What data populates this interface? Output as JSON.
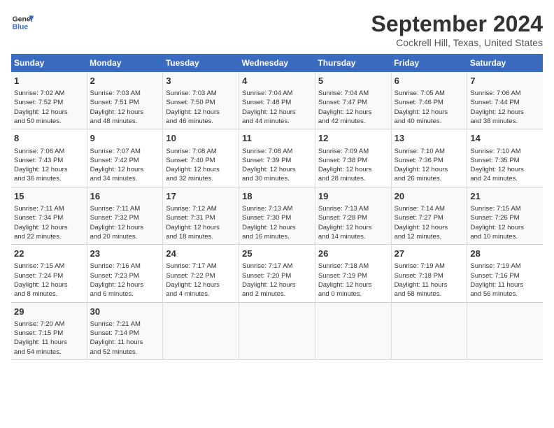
{
  "header": {
    "logo_line1": "General",
    "logo_line2": "Blue",
    "title": "September 2024",
    "subtitle": "Cockrell Hill, Texas, United States"
  },
  "days_of_week": [
    "Sunday",
    "Monday",
    "Tuesday",
    "Wednesday",
    "Thursday",
    "Friday",
    "Saturday"
  ],
  "weeks": [
    [
      {
        "day": "1",
        "info": "Sunrise: 7:02 AM\nSunset: 7:52 PM\nDaylight: 12 hours\nand 50 minutes."
      },
      {
        "day": "2",
        "info": "Sunrise: 7:03 AM\nSunset: 7:51 PM\nDaylight: 12 hours\nand 48 minutes."
      },
      {
        "day": "3",
        "info": "Sunrise: 7:03 AM\nSunset: 7:50 PM\nDaylight: 12 hours\nand 46 minutes."
      },
      {
        "day": "4",
        "info": "Sunrise: 7:04 AM\nSunset: 7:48 PM\nDaylight: 12 hours\nand 44 minutes."
      },
      {
        "day": "5",
        "info": "Sunrise: 7:04 AM\nSunset: 7:47 PM\nDaylight: 12 hours\nand 42 minutes."
      },
      {
        "day": "6",
        "info": "Sunrise: 7:05 AM\nSunset: 7:46 PM\nDaylight: 12 hours\nand 40 minutes."
      },
      {
        "day": "7",
        "info": "Sunrise: 7:06 AM\nSunset: 7:44 PM\nDaylight: 12 hours\nand 38 minutes."
      }
    ],
    [
      {
        "day": "8",
        "info": "Sunrise: 7:06 AM\nSunset: 7:43 PM\nDaylight: 12 hours\nand 36 minutes."
      },
      {
        "day": "9",
        "info": "Sunrise: 7:07 AM\nSunset: 7:42 PM\nDaylight: 12 hours\nand 34 minutes."
      },
      {
        "day": "10",
        "info": "Sunrise: 7:08 AM\nSunset: 7:40 PM\nDaylight: 12 hours\nand 32 minutes."
      },
      {
        "day": "11",
        "info": "Sunrise: 7:08 AM\nSunset: 7:39 PM\nDaylight: 12 hours\nand 30 minutes."
      },
      {
        "day": "12",
        "info": "Sunrise: 7:09 AM\nSunset: 7:38 PM\nDaylight: 12 hours\nand 28 minutes."
      },
      {
        "day": "13",
        "info": "Sunrise: 7:10 AM\nSunset: 7:36 PM\nDaylight: 12 hours\nand 26 minutes."
      },
      {
        "day": "14",
        "info": "Sunrise: 7:10 AM\nSunset: 7:35 PM\nDaylight: 12 hours\nand 24 minutes."
      }
    ],
    [
      {
        "day": "15",
        "info": "Sunrise: 7:11 AM\nSunset: 7:34 PM\nDaylight: 12 hours\nand 22 minutes."
      },
      {
        "day": "16",
        "info": "Sunrise: 7:11 AM\nSunset: 7:32 PM\nDaylight: 12 hours\nand 20 minutes."
      },
      {
        "day": "17",
        "info": "Sunrise: 7:12 AM\nSunset: 7:31 PM\nDaylight: 12 hours\nand 18 minutes."
      },
      {
        "day": "18",
        "info": "Sunrise: 7:13 AM\nSunset: 7:30 PM\nDaylight: 12 hours\nand 16 minutes."
      },
      {
        "day": "19",
        "info": "Sunrise: 7:13 AM\nSunset: 7:28 PM\nDaylight: 12 hours\nand 14 minutes."
      },
      {
        "day": "20",
        "info": "Sunrise: 7:14 AM\nSunset: 7:27 PM\nDaylight: 12 hours\nand 12 minutes."
      },
      {
        "day": "21",
        "info": "Sunrise: 7:15 AM\nSunset: 7:26 PM\nDaylight: 12 hours\nand 10 minutes."
      }
    ],
    [
      {
        "day": "22",
        "info": "Sunrise: 7:15 AM\nSunset: 7:24 PM\nDaylight: 12 hours\nand 8 minutes."
      },
      {
        "day": "23",
        "info": "Sunrise: 7:16 AM\nSunset: 7:23 PM\nDaylight: 12 hours\nand 6 minutes."
      },
      {
        "day": "24",
        "info": "Sunrise: 7:17 AM\nSunset: 7:22 PM\nDaylight: 12 hours\nand 4 minutes."
      },
      {
        "day": "25",
        "info": "Sunrise: 7:17 AM\nSunset: 7:20 PM\nDaylight: 12 hours\nand 2 minutes."
      },
      {
        "day": "26",
        "info": "Sunrise: 7:18 AM\nSunset: 7:19 PM\nDaylight: 12 hours\nand 0 minutes."
      },
      {
        "day": "27",
        "info": "Sunrise: 7:19 AM\nSunset: 7:18 PM\nDaylight: 11 hours\nand 58 minutes."
      },
      {
        "day": "28",
        "info": "Sunrise: 7:19 AM\nSunset: 7:16 PM\nDaylight: 11 hours\nand 56 minutes."
      }
    ],
    [
      {
        "day": "29",
        "info": "Sunrise: 7:20 AM\nSunset: 7:15 PM\nDaylight: 11 hours\nand 54 minutes."
      },
      {
        "day": "30",
        "info": "Sunrise: 7:21 AM\nSunset: 7:14 PM\nDaylight: 11 hours\nand 52 minutes."
      },
      {
        "day": "",
        "info": ""
      },
      {
        "day": "",
        "info": ""
      },
      {
        "day": "",
        "info": ""
      },
      {
        "day": "",
        "info": ""
      },
      {
        "day": "",
        "info": ""
      }
    ]
  ]
}
